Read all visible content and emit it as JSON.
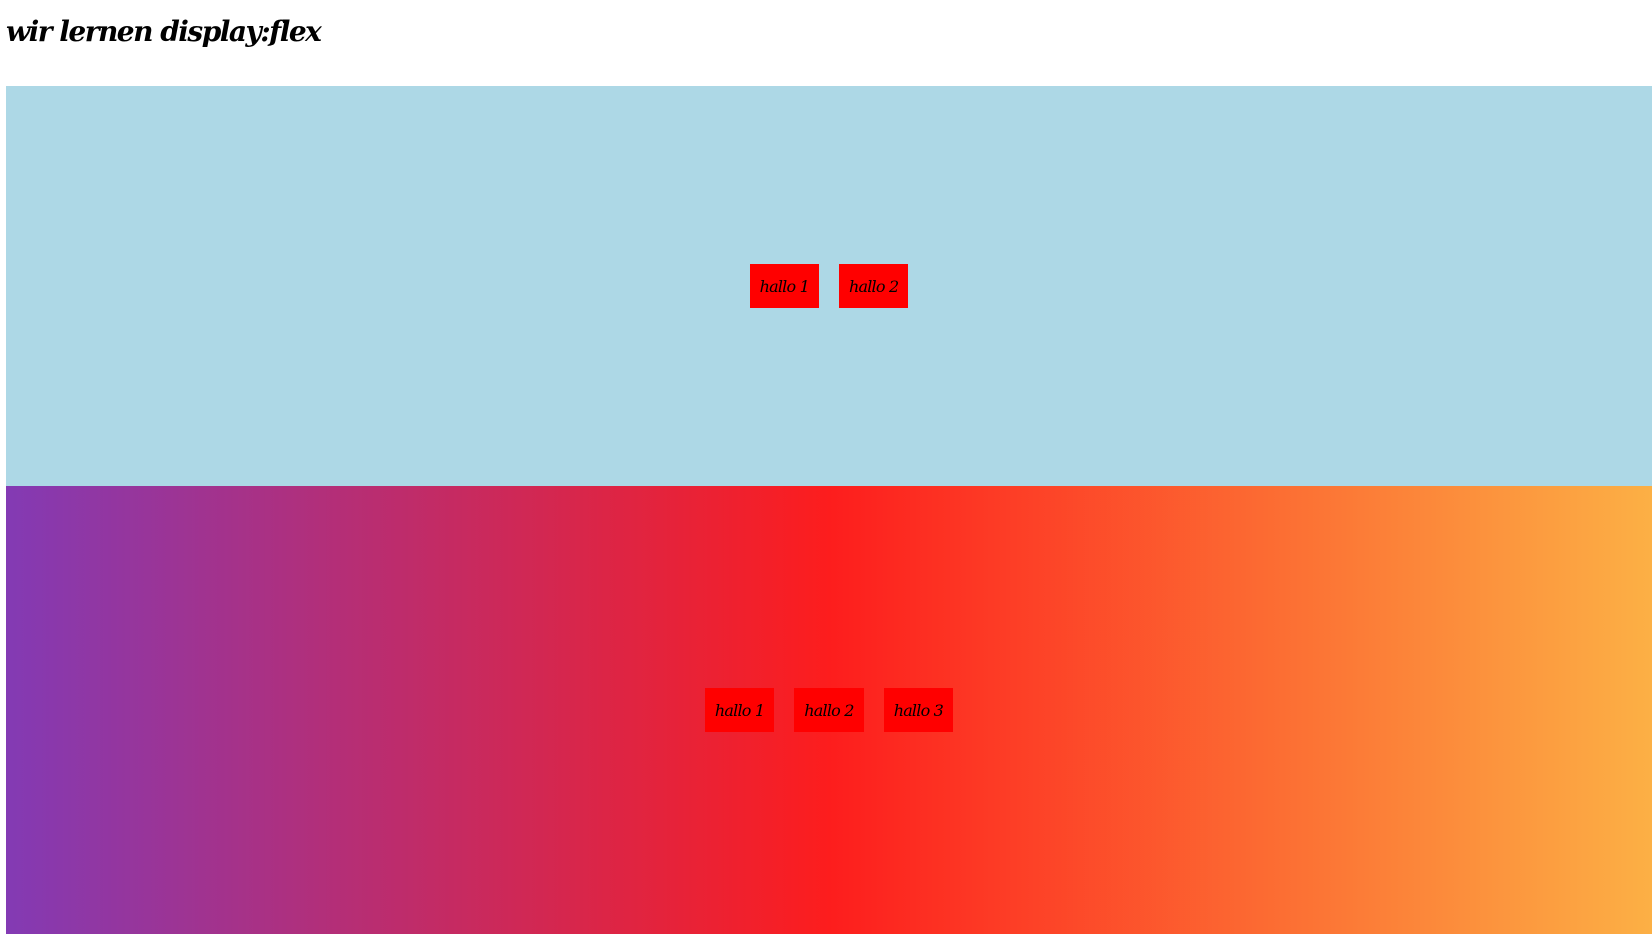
{
  "header": {
    "title": "wir lernen display:flex"
  },
  "containers": [
    {
      "background": "#add8e6",
      "items": [
        {
          "label": "hallo 1"
        },
        {
          "label": "hallo 2"
        }
      ]
    },
    {
      "background_gradient": [
        "#833ab4",
        "#fd1d1d",
        "#fcb045"
      ],
      "items": [
        {
          "label": "hallo 1"
        },
        {
          "label": "hallo 2"
        },
        {
          "label": "hallo 3"
        }
      ]
    }
  ],
  "colors": {
    "item_background": "#ff0000",
    "page_background": "#ffffff",
    "text": "#000000"
  }
}
